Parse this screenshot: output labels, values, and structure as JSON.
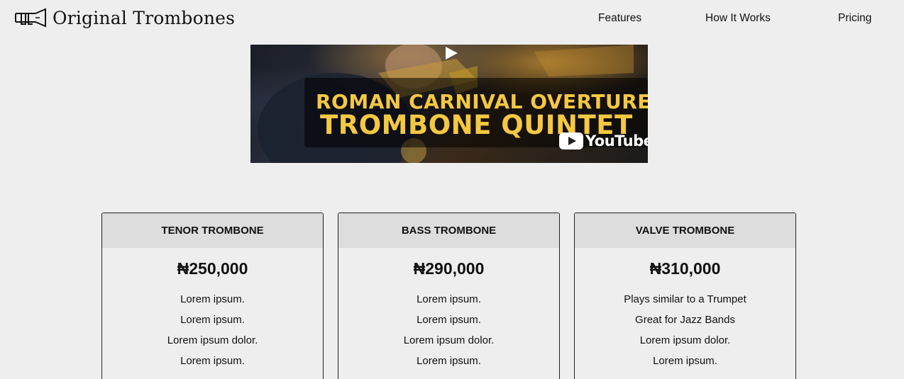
{
  "header": {
    "brand": "Original Trombones",
    "nav": [
      "Features",
      "How It Works",
      "Pricing"
    ]
  },
  "video": {
    "title_line1": "ROMAN CARNIVAL OVERTURE",
    "title_line2": "TROMBONE QUINTET",
    "platform": "YouTube",
    "accent_color": "#f5c842"
  },
  "pricing": [
    {
      "name": "TENOR TROMBONE",
      "price": "₦250,000",
      "features": [
        "Lorem ipsum.",
        "Lorem ipsum.",
        "Lorem ipsum dolor.",
        "Lorem ipsum."
      ]
    },
    {
      "name": "BASS TROMBONE",
      "price": "₦290,000",
      "features": [
        "Lorem ipsum.",
        "Lorem ipsum.",
        "Lorem ipsum dolor.",
        "Lorem ipsum."
      ]
    },
    {
      "name": "VALVE TROMBONE",
      "price": "₦310,000",
      "features": [
        "Plays similar to a Trumpet",
        "Great for Jazz Bands",
        "Lorem ipsum dolor.",
        "Lorem ipsum."
      ]
    }
  ]
}
